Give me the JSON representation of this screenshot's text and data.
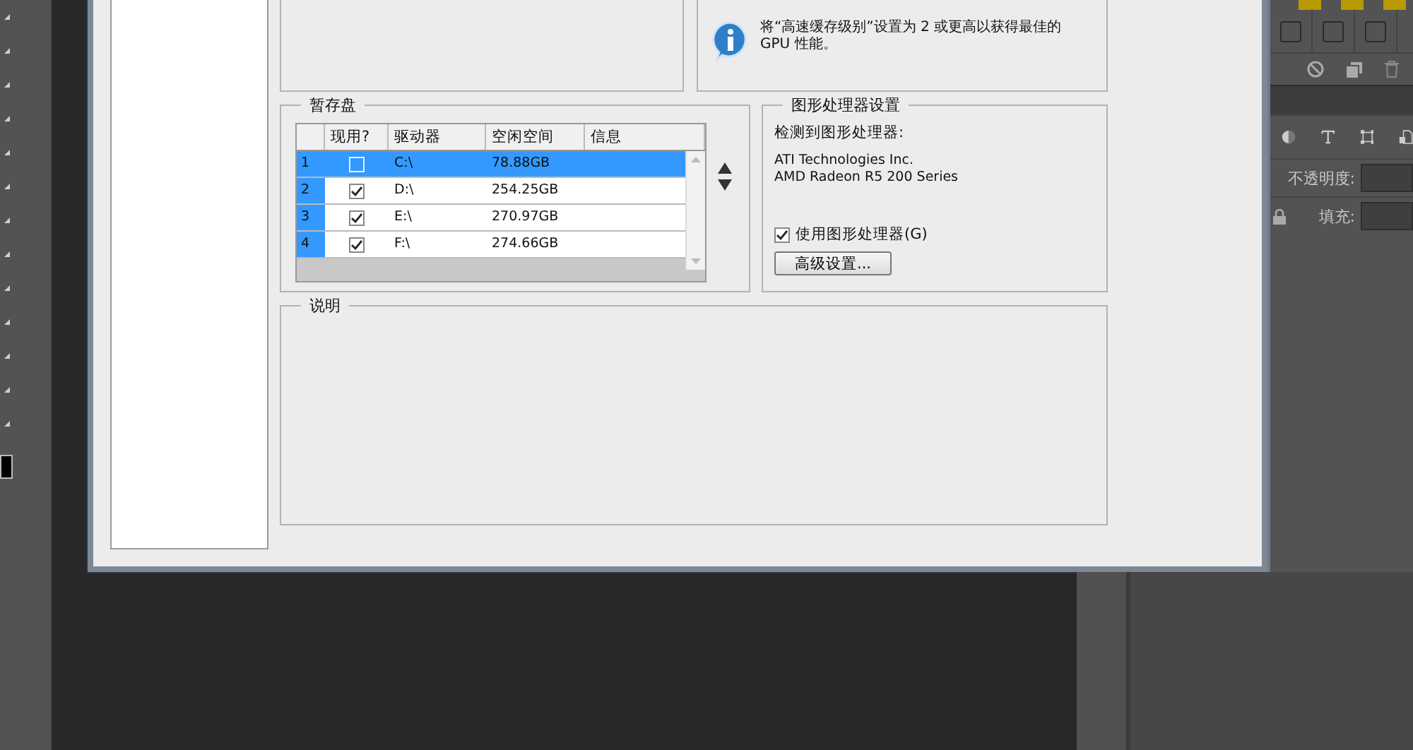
{
  "info": {
    "text": "将“高速缓存级别”设置为 2 或更高以获得最佳的 GPU 性能。"
  },
  "scratch_disks": {
    "title": "暂存盘",
    "columns": [
      "现用?",
      "驱动器",
      "空闲空间",
      "信息"
    ],
    "rows": [
      {
        "index": "1",
        "active": false,
        "drive": "C:\\",
        "free_space": "78.88GB",
        "selected": true
      },
      {
        "index": "2",
        "active": true,
        "drive": "D:\\",
        "free_space": "254.25GB",
        "selected": false
      },
      {
        "index": "3",
        "active": true,
        "drive": "E:\\",
        "free_space": "270.97GB",
        "selected": false
      },
      {
        "index": "4",
        "active": true,
        "drive": "F:\\",
        "free_space": "274.66GB",
        "selected": false
      }
    ]
  },
  "gpu": {
    "title": "图形处理器设置",
    "detected_label": "检测到图形处理器:",
    "vendor": "ATI Technologies Inc.",
    "model": "AMD Radeon R5 200 Series",
    "use_gpu": {
      "label": "使用图形处理器(G)",
      "checked": true
    },
    "advanced_button": "高级设置..."
  },
  "description": {
    "title": "说明"
  },
  "layers_panel": {
    "opacity_label": "不透明度:",
    "fill_label": "填充:"
  }
}
